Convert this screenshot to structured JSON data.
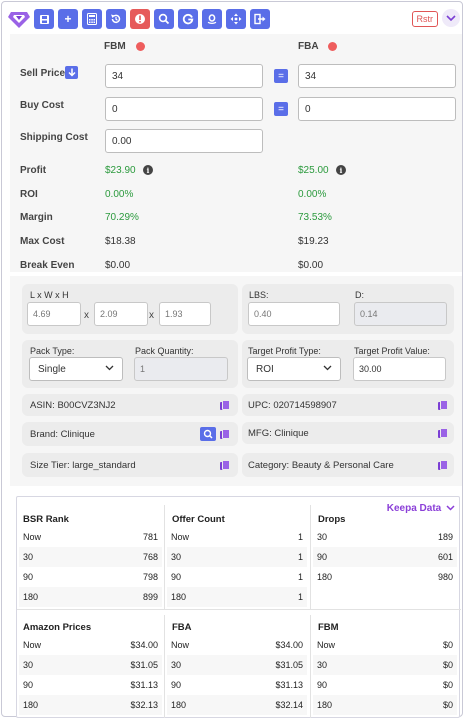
{
  "toolbar": {
    "rstr_label": "Rstr",
    "buttons": [
      "save-icon",
      "plus-icon",
      "calculator-icon",
      "history-icon",
      "alert-icon",
      "search-icon",
      "google-icon",
      "amazon-icon",
      "move-icon",
      "exit-icon"
    ],
    "brand_color": "#5a6ee8",
    "accent_color": "#7b3fd4"
  },
  "calc": {
    "fbm_title": "FBM",
    "fba_title": "FBA",
    "sell_price_label": "Sell Price",
    "buy_cost_label": "Buy Cost",
    "shipping_cost_label": "Shipping Cost",
    "fbm_sell_price": "34",
    "fba_sell_price": "34",
    "fbm_buy_cost": "0",
    "fba_buy_cost": "0",
    "shipping_cost": "0.00",
    "eq_label": "=",
    "profit_label": "Profit",
    "roi_label": "ROI",
    "margin_label": "Margin",
    "max_cost_label": "Max Cost",
    "break_even_label": "Break Even",
    "fbm_profit": "$23.90",
    "fba_profit": "$25.00",
    "fbm_roi": "0.00%",
    "fba_roi": "0.00%",
    "fbm_margin": "70.29%",
    "fba_margin": "73.53%",
    "fbm_max_cost": "$18.38",
    "fba_max_cost": "$19.23",
    "fbm_break_even": "$0.00",
    "fba_break_even": "$0.00",
    "positive_color": "#2b9a3d"
  },
  "dims": {
    "lwh_label": "L x W x H",
    "length": "4.69",
    "width": "2.09",
    "height": "1.93",
    "x_sep": "x",
    "lbs_label": "LBS:",
    "lbs": "0.40",
    "d_label": "D:",
    "d": "0.14",
    "pack_type_label": "Pack Type:",
    "pack_type": "Single",
    "pack_qty_label": "Pack Quantity:",
    "pack_qty": "1",
    "target_profit_type_label": "Target Profit Type:",
    "target_profit_type": "ROI",
    "target_profit_value_label": "Target Profit Value:",
    "target_profit_value": "30.00",
    "asin": "ASIN: B00CVZ3NJ2",
    "upc": "UPC: 020714598907",
    "brand": "Brand: Clinique",
    "mfg": "MFG: Clinique",
    "size_tier": "Size Tier: large_standard",
    "category": "Category: Beauty & Personal Care"
  },
  "keepa": {
    "link_label": "Keepa Data",
    "bsr": {
      "title": "BSR Rank",
      "rows": [
        [
          "Now",
          "781"
        ],
        [
          "30",
          "768"
        ],
        [
          "90",
          "798"
        ],
        [
          "180",
          "899"
        ]
      ]
    },
    "offers": {
      "title": "Offer Count",
      "rows": [
        [
          "Now",
          "1"
        ],
        [
          "30",
          "1"
        ],
        [
          "90",
          "1"
        ],
        [
          "180",
          "1"
        ]
      ]
    },
    "drops": {
      "title": "Drops",
      "rows": [
        [
          "30",
          "189"
        ],
        [
          "90",
          "601"
        ],
        [
          "180",
          "980"
        ]
      ]
    },
    "amazon": {
      "title": "Amazon Prices",
      "rows": [
        [
          "Now",
          "$34.00"
        ],
        [
          "30",
          "$31.05"
        ],
        [
          "90",
          "$31.13"
        ],
        [
          "180",
          "$32.13"
        ]
      ]
    },
    "fba": {
      "title": "FBA",
      "rows": [
        [
          "Now",
          "$34.00"
        ],
        [
          "30",
          "$31.05"
        ],
        [
          "90",
          "$31.13"
        ],
        [
          "180",
          "$32.14"
        ]
      ]
    },
    "fbm": {
      "title": "FBM",
      "rows": [
        [
          "Now",
          "$0"
        ],
        [
          "30",
          "$0"
        ],
        [
          "90",
          "$0"
        ],
        [
          "180",
          "$0"
        ]
      ]
    }
  }
}
